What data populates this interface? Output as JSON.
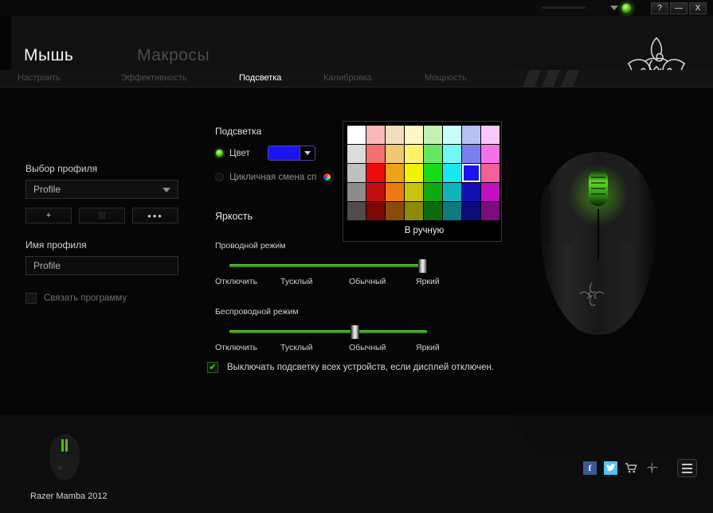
{
  "titlebar": {
    "help_label": "?",
    "minimize_label": "—",
    "close_label": "X",
    "led_name": "status-led",
    "redacted_name": "redacted-account-name"
  },
  "header": {
    "main_tabs": [
      {
        "label": "Мышь",
        "active": true
      },
      {
        "label": "Макросы",
        "active": false
      }
    ],
    "sub_tabs": [
      {
        "label": "Настроить",
        "active": false
      },
      {
        "label": "Эффективность",
        "active": false
      },
      {
        "label": "Подсветка",
        "active": true
      },
      {
        "label": "Калибровка",
        "active": false
      },
      {
        "label": "Мощность",
        "active": false
      }
    ]
  },
  "profile": {
    "select_label": "Выбор профиля",
    "selected_profile": "Profile",
    "add_label": "+",
    "delete_label": "☒",
    "more_label": "•••",
    "name_label": "Имя профиля",
    "name_value": "Profile",
    "link_program_label": "Связать программу",
    "link_program_checked": false
  },
  "lighting": {
    "title": "Подсветка",
    "color_option_label": "Цвет",
    "color_option_selected": true,
    "cycle_option_label": "Цикличная смена сп",
    "cycle_option_selected": false,
    "selected_color": "#1a14f0"
  },
  "palette": {
    "manual_label": "В ручную",
    "selected_index": 22,
    "colors": [
      "#ffffff",
      "#f7b9b9",
      "#f2ddbd",
      "#fdf6c5",
      "#c4f0b5",
      "#c8fbfb",
      "#b8c0f2",
      "#f8c8f8",
      "#dcdcdc",
      "#f2706e",
      "#f0c870",
      "#fbf46a",
      "#62e861",
      "#72f8f4",
      "#7a7ef0",
      "#f472e8",
      "#c0c0c0",
      "#ee0b0b",
      "#eda41a",
      "#f2f206",
      "#15dc15",
      "#16eaf0",
      "#1a14f0",
      "#f45f9a",
      "#8c8c8c",
      "#c10e0e",
      "#ee7a12",
      "#c8c40c",
      "#10a810",
      "#12b4bc",
      "#1410b4",
      "#c010c0",
      "#4d4d4d",
      "#7e0808",
      "#8a4a0a",
      "#8c8a08",
      "#0a6c0a",
      "#0c7a80",
      "#0c0a7c",
      "#7c0c7c"
    ]
  },
  "brightness": {
    "title": "Яркость",
    "wired_label": "Проводной режим",
    "wireless_label": "Беспроводной режим",
    "ticks": [
      "Отключить",
      "Тусклый",
      "Обычный",
      "Яркий"
    ],
    "wired_value": 100,
    "wireless_value": 64
  },
  "display_off": {
    "label": "Выключать подсветку всех устройств, если дисплей отключен.",
    "checked": true,
    "check_glyph": "✔"
  },
  "footer": {
    "device_name": "Razer Mamba 2012",
    "facebook_label": "f",
    "twitter_label": "✉",
    "cart_label": "🛒",
    "razer_label": "razer-logo-icon"
  },
  "theme": {
    "accent_green": "#5fc13a",
    "led_green": "#5fd41f",
    "text_primary": "#e0e0e0",
    "text_dim": "#4d4d4d"
  }
}
